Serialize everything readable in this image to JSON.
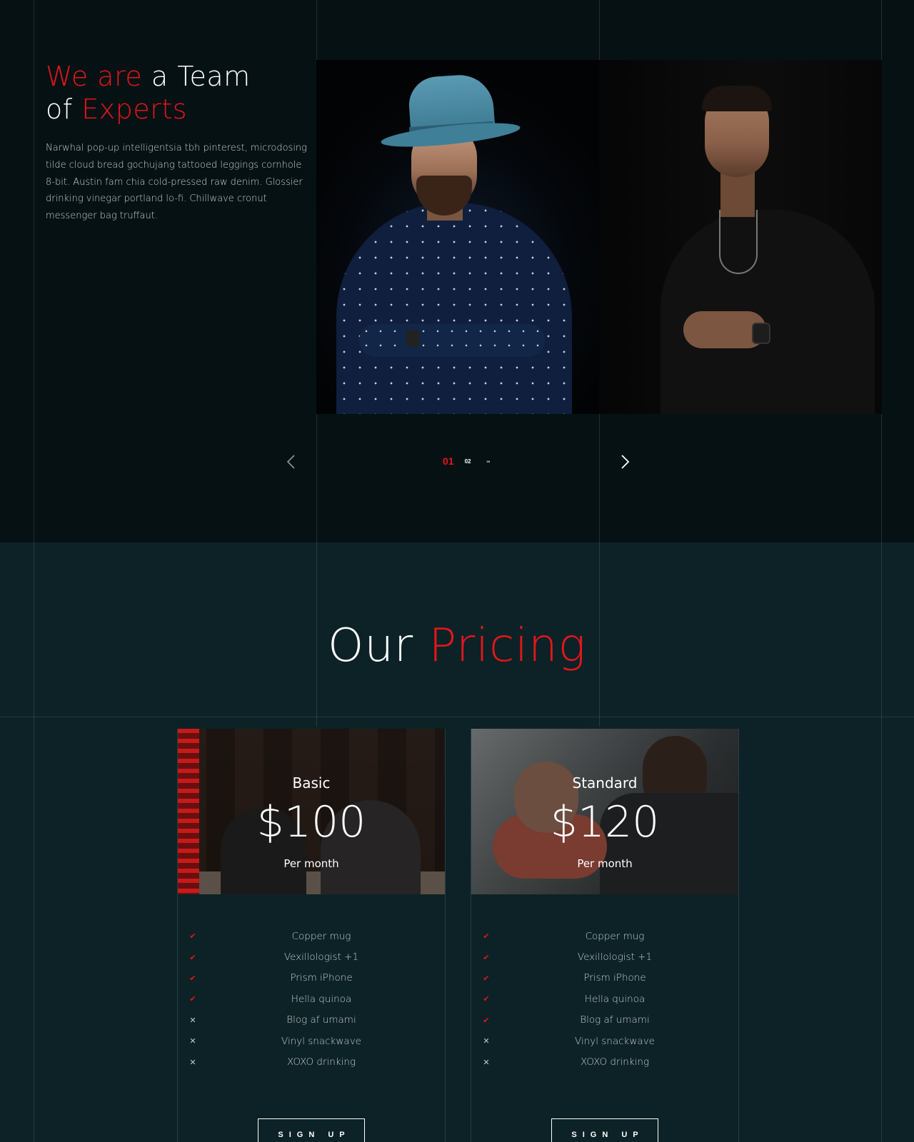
{
  "team": {
    "title_accent_1": "We are",
    "title_plain_1": " a Team",
    "title_plain_2": "of ",
    "title_accent_2": "Experts",
    "description": "Narwhal pop-up intelligentsia tbh pinterest, microdosing tilde cloud bread gochujang tattooed leggings cornhole 8-bit. Austin fam chia cold-pressed raw denim. Glossier drinking vinegar portland lo-fi. Chillwave cronut messenger bag truffaut.",
    "slider": {
      "pages": [
        "01",
        "02",
        "03"
      ],
      "current_page": 1,
      "prev_icon": "chevron-left-icon",
      "next_icon": "chevron-right-icon"
    }
  },
  "pricing": {
    "title_plain": "Our ",
    "title_accent": "Pricing",
    "plans": [
      {
        "name": "Basic",
        "price": "$100",
        "period": "Per month",
        "features": [
          {
            "label": "Copper mug",
            "included": true
          },
          {
            "label": "Vexillologist +1",
            "included": true
          },
          {
            "label": "Prism iPhone",
            "included": true
          },
          {
            "label": "Hella quinoa",
            "included": true
          },
          {
            "label": "Blog af umami",
            "included": false
          },
          {
            "label": "Vinyl snackwave",
            "included": false
          },
          {
            "label": "XOXO drinking",
            "included": false
          }
        ],
        "cta": "SIGN UP"
      },
      {
        "name": "Standard",
        "price": "$120",
        "period": "Per month",
        "features": [
          {
            "label": "Copper mug",
            "included": true
          },
          {
            "label": "Vexillologist +1",
            "included": true
          },
          {
            "label": "Prism iPhone",
            "included": true
          },
          {
            "label": "Hella quinoa",
            "included": true
          },
          {
            "label": "Blog af umami",
            "included": true
          },
          {
            "label": "Vinyl snackwave",
            "included": false
          },
          {
            "label": "XOXO drinking",
            "included": false
          }
        ],
        "cta": "SIGN UP"
      }
    ]
  },
  "colors": {
    "accent": "#e3161b",
    "team_bg": "#061114",
    "pricing_bg": "#0c2226"
  }
}
